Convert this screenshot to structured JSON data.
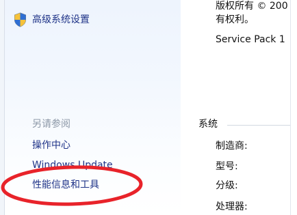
{
  "left_pane": {
    "advanced_settings": "高级系统设置",
    "see_also_heading": "另请参阅",
    "tasks": [
      "操作中心",
      "Windows Update",
      "性能信息和工具"
    ]
  },
  "right_pane": {
    "copyright_line1": "版权所有 © 200",
    "copyright_line2": "有权利。",
    "service_pack": "Service Pack 1",
    "system_section": "系统",
    "fields": [
      "制造商:",
      "型号:",
      "分级:",
      "处理器:"
    ]
  },
  "colors": {
    "link": "#1e3287",
    "muted": "#8e99a8",
    "annotation": "#e8232a"
  },
  "icons": {
    "advanced_settings_icon": "uac-shield-icon"
  }
}
